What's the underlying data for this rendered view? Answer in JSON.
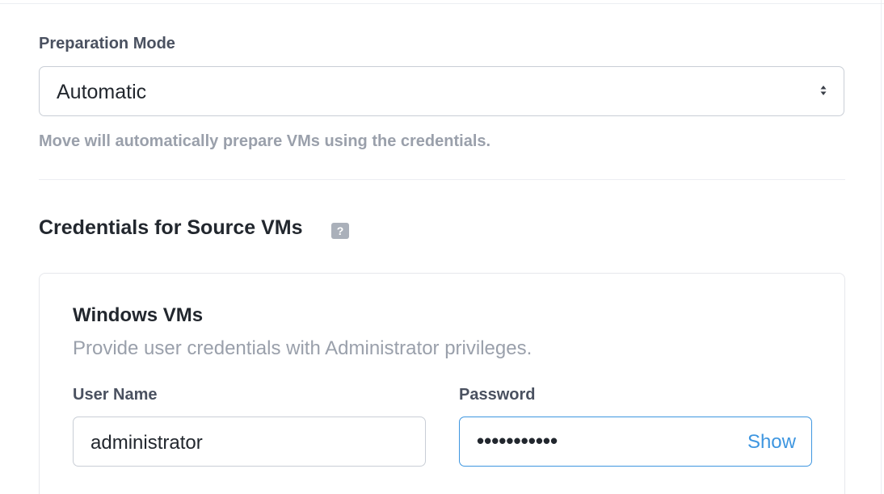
{
  "preparation_mode": {
    "label": "Preparation Mode",
    "selected_value": "Automatic",
    "help_text": "Move will automatically prepare VMs using the credentials."
  },
  "credentials_section": {
    "title": "Credentials for Source VMs",
    "help_icon": "?",
    "windows_card": {
      "title": "Windows VMs",
      "subtitle": "Provide user credentials with Administrator privileges.",
      "username": {
        "label": "User Name",
        "value": "administrator"
      },
      "password": {
        "label": "Password",
        "masked_value": "•••••••••••",
        "show_label": "Show"
      }
    }
  },
  "colors": {
    "accent": "#3e96e0",
    "muted_text": "#9aa0ab",
    "border": "#c9ced6"
  },
  "icons": {
    "select_arrows": "chevron-up-down-icon",
    "help": "question-mark-icon"
  }
}
